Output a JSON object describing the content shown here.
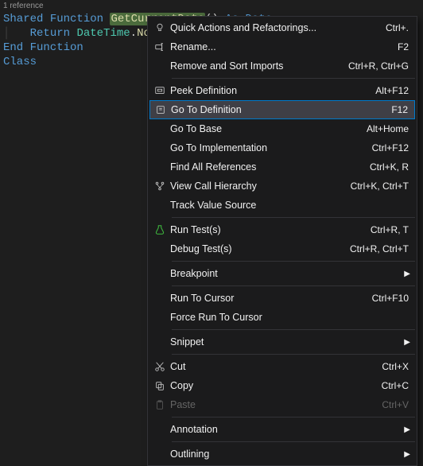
{
  "codelens": "1 reference",
  "code": {
    "l1": {
      "p1": "Shared",
      "p2": "Function",
      "p3": "GetCurrentDate",
      "p4": "()",
      "p5": "As",
      "p6": "Date"
    },
    "l2": {
      "p1": "Return",
      "p2": "DateTime",
      "p3": ".",
      "p4": "Now",
      "p5": "."
    },
    "l3": "End Function",
    "l4": "Class"
  },
  "menu": {
    "quickActions": {
      "label": "Quick Actions and Refactorings...",
      "shortcut": "Ctrl+."
    },
    "rename": {
      "label": "Rename...",
      "shortcut": "F2"
    },
    "removeSort": {
      "label": "Remove and Sort Imports",
      "shortcut": "Ctrl+R, Ctrl+G"
    },
    "peekDef": {
      "label": "Peek Definition",
      "shortcut": "Alt+F12"
    },
    "gotoDef": {
      "label": "Go To Definition",
      "shortcut": "F12"
    },
    "gotoBase": {
      "label": "Go To Base",
      "shortcut": "Alt+Home"
    },
    "gotoImpl": {
      "label": "Go To Implementation",
      "shortcut": "Ctrl+F12"
    },
    "findRefs": {
      "label": "Find All References",
      "shortcut": "Ctrl+K, R"
    },
    "callHier": {
      "label": "View Call Hierarchy",
      "shortcut": "Ctrl+K, Ctrl+T"
    },
    "trackValue": {
      "label": "Track Value Source",
      "shortcut": ""
    },
    "runTests": {
      "label": "Run Test(s)",
      "shortcut": "Ctrl+R, T"
    },
    "debugTests": {
      "label": "Debug Test(s)",
      "shortcut": "Ctrl+R, Ctrl+T"
    },
    "breakpoint": {
      "label": "Breakpoint",
      "shortcut": ""
    },
    "runToCursor": {
      "label": "Run To Cursor",
      "shortcut": "Ctrl+F10"
    },
    "forceRun": {
      "label": "Force Run To Cursor",
      "shortcut": ""
    },
    "snippet": {
      "label": "Snippet",
      "shortcut": ""
    },
    "cut": {
      "label": "Cut",
      "shortcut": "Ctrl+X"
    },
    "copy": {
      "label": "Copy",
      "shortcut": "Ctrl+C"
    },
    "paste": {
      "label": "Paste",
      "shortcut": "Ctrl+V"
    },
    "annotation": {
      "label": "Annotation",
      "shortcut": ""
    },
    "outlining": {
      "label": "Outlining",
      "shortcut": ""
    }
  }
}
